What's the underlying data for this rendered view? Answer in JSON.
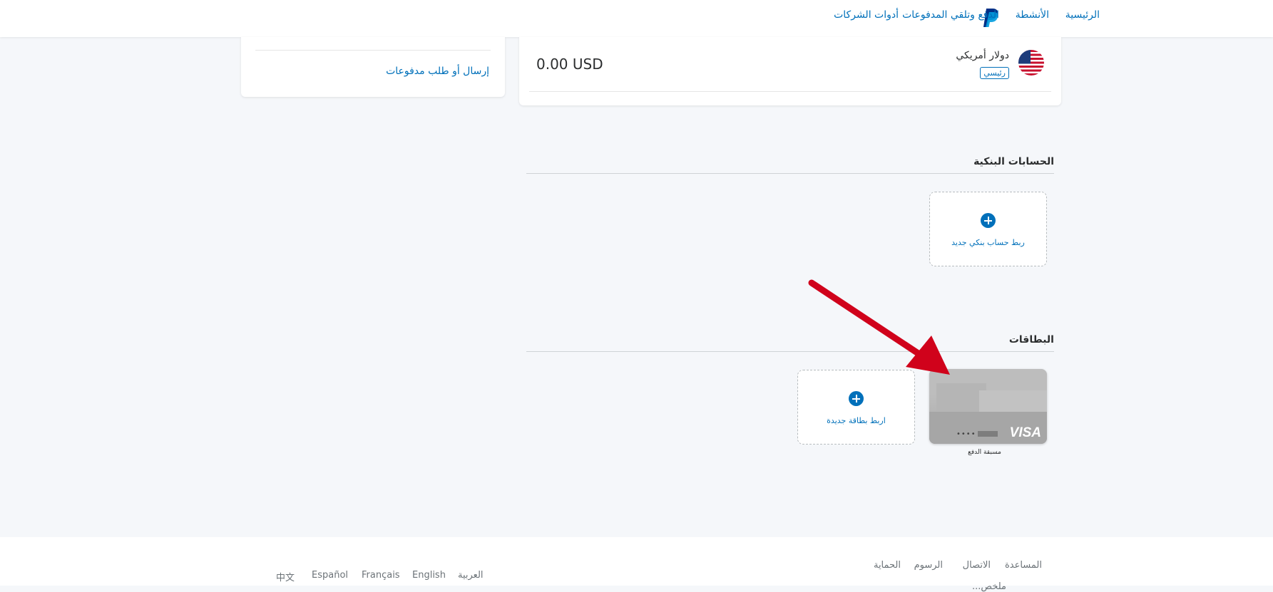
{
  "nav": {
    "items": [
      "الرئيسية",
      "الأنشطة",
      "الدفع وتلقي المدفوعات",
      "أدوات الشركات"
    ]
  },
  "balance": {
    "currency_name": "دولار أمريكي",
    "primary_badge": "رئيسي",
    "amount": "0.00 USD"
  },
  "side": {
    "send_request_link": "إرسال أو طلب مدفوعات"
  },
  "bank_accounts": {
    "title": "الحسابات البنكية",
    "link_label": "ربط حساب بنكي جديد"
  },
  "cards": {
    "title": "البطاقات",
    "link_label": "اربط بطاقة جديدة",
    "card_brand": "VISA",
    "card_masked": "••••",
    "card_caption": "مسبقة الدفع"
  },
  "footer": {
    "links": [
      "المساعدة",
      "الاتصال",
      "الرسوم",
      "الحماية"
    ],
    "languages": [
      "العربية",
      "English",
      "Français",
      "Español",
      "中文"
    ],
    "cut_text": "ملخص..."
  },
  "colors": {
    "brand_blue": "#0070ba",
    "annotation_red": "#d0021b"
  },
  "icons": [
    "paypal-logo-icon",
    "us-flag-icon",
    "plus-icon",
    "visa-logo",
    "red-arrow-annotation"
  ]
}
